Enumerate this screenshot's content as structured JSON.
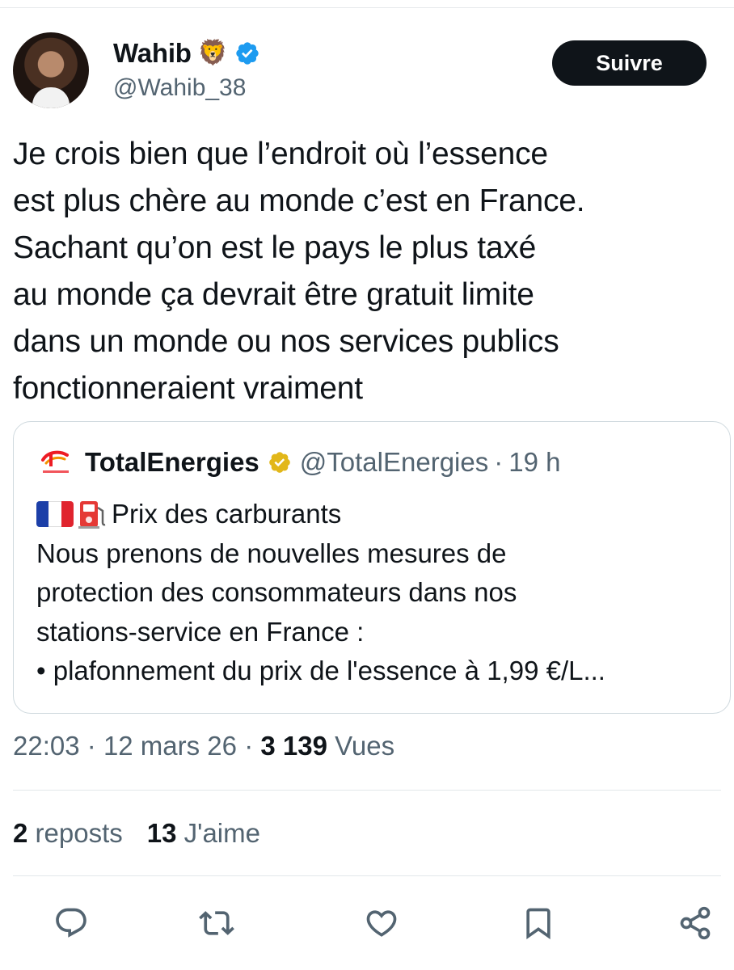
{
  "author": {
    "display_name": "Wahib",
    "name_emoji": "🦁",
    "handle": "@Wahib_38",
    "verified": true,
    "verified_color": "#1d9bf0"
  },
  "follow_button": {
    "label": "Suivre"
  },
  "tweet": {
    "lines": [
      "Je crois bien que l’endroit où l’essence",
      "est plus chère au monde c’est en France.",
      "Sachant qu’on est le pays le plus taxé",
      "au monde ça devrait être gratuit limite",
      "dans un monde ou nos services publics",
      "fonctionneraient vraiment"
    ]
  },
  "quoted": {
    "display_name": "TotalEnergies",
    "handle": "@TotalEnergies",
    "separator": "·",
    "time": "19 h",
    "badge_color": "#e2b719",
    "title_emojis": [
      "flag-france-icon",
      "fuel-pump-icon"
    ],
    "title": "Prix des carburants",
    "lines": [
      "Nous prenons de nouvelles mesures de",
      "protection des consommateurs dans nos",
      "stations-service en France :",
      "• plafonnement du prix de l'essence à 1,99 €/L..."
    ]
  },
  "meta": {
    "time": "22:03",
    "sep1": "·",
    "date": "12 mars 26",
    "sep2": "·",
    "views_count": "3 139",
    "views_label": "Vues"
  },
  "stats": {
    "reposts_count": "2",
    "reposts_label": "reposts",
    "likes_count": "13",
    "likes_label": "J'aime"
  },
  "actions": [
    "reply-icon",
    "repost-icon",
    "like-icon",
    "bookmark-icon",
    "share-icon"
  ],
  "colors": {
    "text": "#0f1419",
    "secondary": "#536471",
    "border": "#cfd9de"
  }
}
